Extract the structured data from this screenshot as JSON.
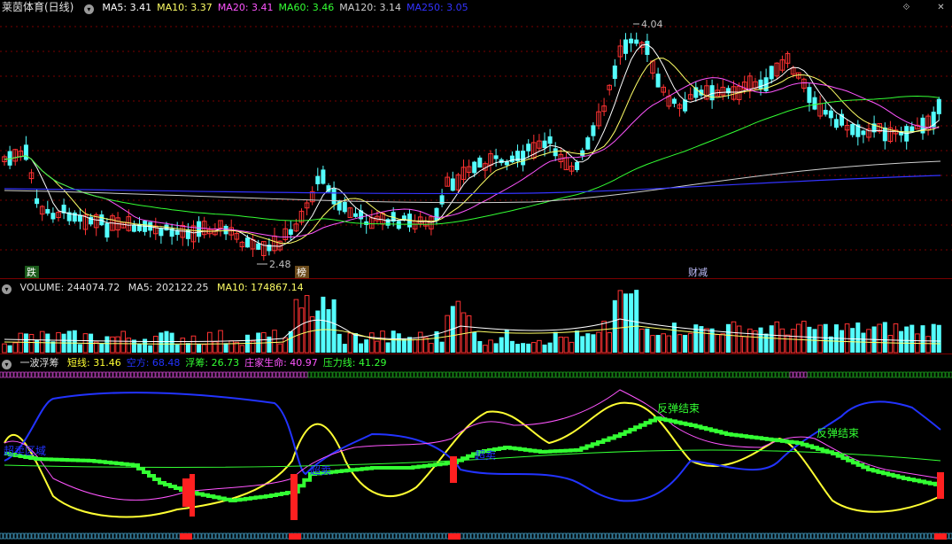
{
  "main": {
    "title": "莱茵体育(日线)",
    "indicators": [
      {
        "label": "MA5: 3.41",
        "color": "#ffffff"
      },
      {
        "label": "MA10: 3.37",
        "color": "#ffff66"
      },
      {
        "label": "MA20: 3.41",
        "color": "#ff55ff"
      },
      {
        "label": "MA60: 3.46",
        "color": "#33ff33"
      },
      {
        "label": "MA120: 3.14",
        "color": "#d0d0d0"
      },
      {
        "label": "MA250: 3.05",
        "color": "#3333ff"
      }
    ],
    "high_label": "4.04",
    "low_label": "2.48",
    "markers": [
      "跌",
      "榜",
      "财减"
    ]
  },
  "volume": {
    "title": "VOLUME: 244074.72",
    "ma5": "MA5: 202122.25",
    "ma10": "MA10: 174867.14"
  },
  "indicator": {
    "title": "一波浮筹",
    "items": [
      {
        "label": "短线: 31.46",
        "color": "#ffff33"
      },
      {
        "label": "空方: 68.48",
        "color": "#2233ff"
      },
      {
        "label": "浮筹: 26.73",
        "color": "#33ff33"
      },
      {
        "label": "庄家生命: 40.97",
        "color": "#ff55ff"
      },
      {
        "label": "压力线: 41.29",
        "color": "#33ff33"
      }
    ],
    "annotations": [
      "反弹结束",
      "反弹结束",
      "超卖区域",
      "超卖",
      "超卖"
    ]
  },
  "colors": {
    "up": "#ff3232",
    "down": "#54ffff",
    "grid": "#7a0000"
  }
}
